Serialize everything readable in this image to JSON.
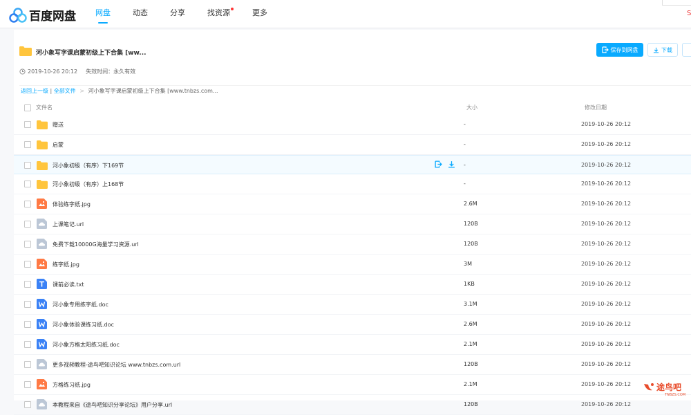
{
  "app": {
    "logo_text": "百度网盘"
  },
  "nav": [
    {
      "label": "网盘",
      "active": true
    },
    {
      "label": "动态",
      "active": false
    },
    {
      "label": "分享",
      "active": false
    },
    {
      "label": "找资源",
      "active": false,
      "dot": true
    },
    {
      "label": "更多",
      "active": false
    }
  ],
  "top_right_text": "S",
  "share": {
    "title": "河小象写字课启蒙初级上下合集 [ww...",
    "created": "2019-10-26 20:12",
    "expiry": "失效时间：永久有效",
    "save_button": "保存到网盘",
    "download_button": "下载"
  },
  "breadcrumb": {
    "back": "返回上一级",
    "all": "全部文件",
    "separator": "|",
    "arrow": ">",
    "current": "河小象写字课启蒙初级上下合集 [www.tnbzs.com..."
  },
  "columns": {
    "name": "文件名",
    "size": "大小",
    "date": "修改日期"
  },
  "files": [
    {
      "name": "赠送",
      "size": "-",
      "date": "2019-10-26 20:12",
      "type": "folder"
    },
    {
      "name": "启蒙",
      "size": "-",
      "date": "2019-10-26 20:12",
      "type": "folder"
    },
    {
      "name": "河小象初级（有序）下169节",
      "size": "-",
      "date": "2019-10-26 20:12",
      "type": "folder",
      "hover": true
    },
    {
      "name": "河小象初级（有序）上168节",
      "size": "-",
      "date": "2019-10-26 20:12",
      "type": "folder"
    },
    {
      "name": "体验练字纸.jpg",
      "size": "2.6M",
      "date": "2019-10-26 20:12",
      "type": "image"
    },
    {
      "name": "上课笔记.url",
      "size": "120B",
      "date": "2019-10-26 20:12",
      "type": "url"
    },
    {
      "name": "免费下载10000G海量学习资源.url",
      "size": "120B",
      "date": "2019-10-26 20:12",
      "type": "url"
    },
    {
      "name": "练字纸.jpg",
      "size": "3M",
      "date": "2019-10-26 20:12",
      "type": "image"
    },
    {
      "name": "课前必读.txt",
      "size": "1KB",
      "date": "2019-10-26 20:12",
      "type": "text"
    },
    {
      "name": "河小象专用练字纸.doc",
      "size": "3.1M",
      "date": "2019-10-26 20:12",
      "type": "word"
    },
    {
      "name": "河小象体验课练习纸.doc",
      "size": "2.6M",
      "date": "2019-10-26 20:12",
      "type": "word"
    },
    {
      "name": "河小象方格太阳练习纸.doc",
      "size": "2.1M",
      "date": "2019-10-26 20:12",
      "type": "word"
    },
    {
      "name": "更多视频教程-途鸟吧知识论坛 www.tnbzs.com.url",
      "size": "120B",
      "date": "2019-10-26 20:12",
      "type": "url"
    },
    {
      "name": "方格练习纸.jpg",
      "size": "2.1M",
      "date": "2019-10-26 20:12",
      "type": "image"
    },
    {
      "name": "本教程来自《途鸟吧知识分享论坛》用户分享.url",
      "size": "120B",
      "date": "2019-10-26 20:12",
      "type": "url"
    }
  ],
  "watermark": {
    "text": "途鸟吧",
    "sub": "TNBZS.COM"
  },
  "colors": {
    "accent": "#09aaff",
    "folder": "#ffc53d",
    "image": "#ff7a45",
    "word": "#3b82f6",
    "url": "#bcc7d6"
  }
}
